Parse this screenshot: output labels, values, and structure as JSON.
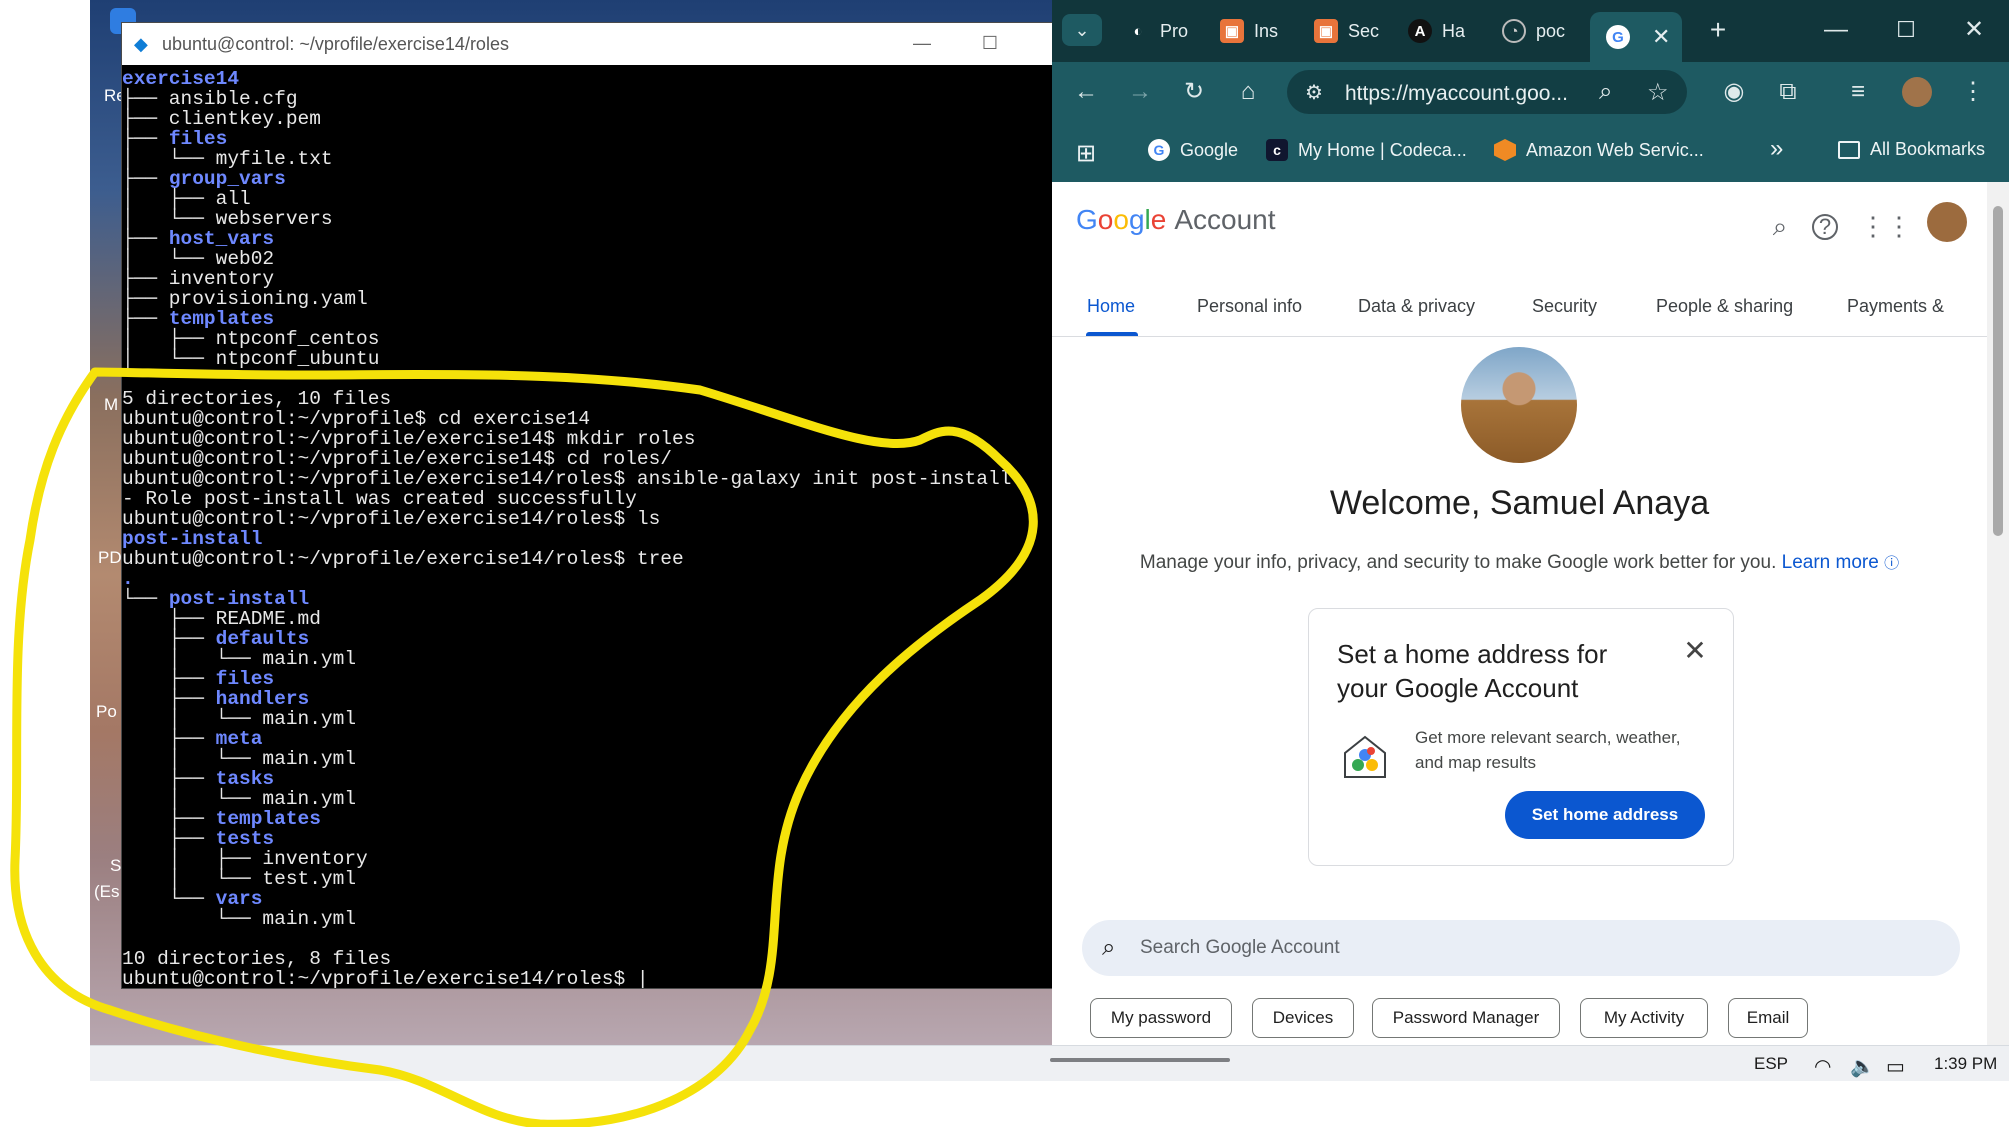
{
  "desktop": {
    "icon_labels": [
      "Re",
      "M",
      "PD",
      "Po",
      "S",
      "(Es"
    ]
  },
  "terminal": {
    "title": "ubuntu@control: ~/vprofile/exercise14/roles",
    "lines": [
      [
        {
          "t": "exercise14",
          "d": true
        }
      ],
      [
        {
          "t": "├── ansible.cfg"
        }
      ],
      [
        {
          "t": "├── clientkey.pem"
        }
      ],
      [
        {
          "t": "├── "
        },
        {
          "t": "files",
          "d": true
        }
      ],
      [
        {
          "t": "│   └── myfile.txt"
        }
      ],
      [
        {
          "t": "├── "
        },
        {
          "t": "group_vars",
          "d": true
        }
      ],
      [
        {
          "t": "│   ├── all"
        }
      ],
      [
        {
          "t": "│   └── webservers"
        }
      ],
      [
        {
          "t": "├── "
        },
        {
          "t": "host_vars",
          "d": true
        }
      ],
      [
        {
          "t": "│   └── web02"
        }
      ],
      [
        {
          "t": "├── inventory"
        }
      ],
      [
        {
          "t": "├── provisioning.yaml"
        }
      ],
      [
        {
          "t": "├── "
        },
        {
          "t": "templates",
          "d": true
        }
      ],
      [
        {
          "t": "│   ├── ntpconf_centos"
        }
      ],
      [
        {
          "t": "│   └── ntpconf_ubuntu"
        }
      ],
      [
        {
          "t": ""
        }
      ],
      [
        {
          "t": "5 directories, 10 files"
        }
      ],
      [
        {
          "t": "ubuntu@control:~/vprofile$ cd exercise14"
        }
      ],
      [
        {
          "t": "ubuntu@control:~/vprofile/exercise14$ mkdir roles"
        }
      ],
      [
        {
          "t": "ubuntu@control:~/vprofile/exercise14$ cd roles/"
        }
      ],
      [
        {
          "t": "ubuntu@control:~/vprofile/exercise14/roles$ ansible-galaxy init post-install"
        }
      ],
      [
        {
          "t": "- Role post-install was created successfully"
        }
      ],
      [
        {
          "t": "ubuntu@control:~/vprofile/exercise14/roles$ ls"
        }
      ],
      [
        {
          "t": "post-install",
          "d": true
        }
      ],
      [
        {
          "t": "ubuntu@control:~/vprofile/exercise14/roles$ tree"
        }
      ],
      [
        {
          "t": ".",
          "d": true
        }
      ],
      [
        {
          "t": "└── "
        },
        {
          "t": "post-install",
          "d": true
        }
      ],
      [
        {
          "t": "    ├── README.md"
        }
      ],
      [
        {
          "t": "    ├── "
        },
        {
          "t": "defaults",
          "d": true
        }
      ],
      [
        {
          "t": "    │   └── main.yml"
        }
      ],
      [
        {
          "t": "    ├── "
        },
        {
          "t": "files",
          "d": true
        }
      ],
      [
        {
          "t": "    ├── "
        },
        {
          "t": "handlers",
          "d": true
        }
      ],
      [
        {
          "t": "    │   └── main.yml"
        }
      ],
      [
        {
          "t": "    ├── "
        },
        {
          "t": "meta",
          "d": true
        }
      ],
      [
        {
          "t": "    │   └── main.yml"
        }
      ],
      [
        {
          "t": "    ├── "
        },
        {
          "t": "tasks",
          "d": true
        }
      ],
      [
        {
          "t": "    │   └── main.yml"
        }
      ],
      [
        {
          "t": "    ├── "
        },
        {
          "t": "templates",
          "d": true
        }
      ],
      [
        {
          "t": "    ├── "
        },
        {
          "t": "tests",
          "d": true
        }
      ],
      [
        {
          "t": "    │   ├── inventory"
        }
      ],
      [
        {
          "t": "    │   └── test.yml"
        }
      ],
      [
        {
          "t": "    └── "
        },
        {
          "t": "vars",
          "d": true
        }
      ],
      [
        {
          "t": "        └── main.yml"
        }
      ],
      [
        {
          "t": ""
        }
      ],
      [
        {
          "t": "10 directories, 8 files"
        }
      ],
      [
        {
          "t": "ubuntu@control:~/vprofile/exercise14/roles$ |"
        }
      ]
    ]
  },
  "browser": {
    "tabs": [
      {
        "label": "Pro",
        "icon": "github-icon"
      },
      {
        "label": "Ins",
        "icon": "aws-icon"
      },
      {
        "label": "Sec",
        "icon": "aws-icon"
      },
      {
        "label": "Ha",
        "icon": "anthropic-icon"
      },
      {
        "label": "poc",
        "icon": "clock-icon"
      },
      {
        "label": "",
        "icon": "google-icon",
        "active": true
      }
    ],
    "url": "https://myaccount.goo...",
    "bookmarks": [
      {
        "label": "Google",
        "icon": "google-icon"
      },
      {
        "label": "My Home | Codeca...",
        "icon": "codecademy-icon"
      },
      {
        "label": "Amazon Web Servic...",
        "icon": "aws-icon"
      }
    ],
    "bookmarks_more": "»",
    "all_bookmarks": "All Bookmarks"
  },
  "google_account": {
    "logo_letters": [
      "G",
      "o",
      "o",
      "g",
      "l",
      "e"
    ],
    "logo_suffix": "Account",
    "nav_tabs": [
      "Home",
      "Personal info",
      "Data & privacy",
      "Security",
      "People & sharing",
      "Payments &"
    ],
    "welcome": "Welcome, Samuel Anaya",
    "subtitle": "Manage your info, privacy, and security to make Google work better for you.",
    "learn_more": "Learn more",
    "card": {
      "title": "Set a home address for your Google Account",
      "description": "Get more relevant search, weather, and map results",
      "button": "Set home address"
    },
    "search_placeholder": "Search Google Account",
    "chips": [
      "My password",
      "Devices",
      "Password Manager",
      "My Activity",
      "Email"
    ]
  },
  "taskbar": {
    "language": "ESP",
    "time": "1:39 PM"
  },
  "colors": {
    "annotation": "#f5e20a",
    "chrome_frame": "#11363b",
    "chrome_toolbar": "#1e5a62",
    "terminal_dir": "#6e88ff",
    "google_blue": "#0b57d0"
  }
}
